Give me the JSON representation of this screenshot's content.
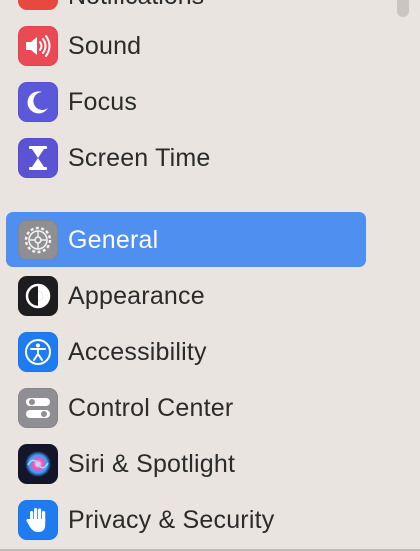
{
  "sidebar": {
    "partial_top_item": {
      "label": "Notifications",
      "icon": "bell-icon"
    },
    "items": [
      {
        "label": "Sound",
        "icon": "speaker-icon",
        "color": "#e8484f"
      },
      {
        "label": "Focus",
        "icon": "moon-icon",
        "color": "#5b58d9"
      },
      {
        "label": "Screen Time",
        "icon": "hourglass-icon",
        "color": "#5b52d4"
      },
      {
        "label": "General",
        "icon": "gear-icon",
        "color": "#8e8e93",
        "selected": true
      },
      {
        "label": "Appearance",
        "icon": "appearance-icon",
        "color": "#1d1d1f"
      },
      {
        "label": "Accessibility",
        "icon": "accessibility-icon",
        "color": "#1f7cf0"
      },
      {
        "label": "Control Center",
        "icon": "toggles-icon",
        "color": "#8e8e93"
      },
      {
        "label": "Siri & Spotlight",
        "icon": "siri-icon",
        "color": "#1a1a2e"
      },
      {
        "label": "Privacy & Security",
        "icon": "hand-icon",
        "color": "#1f7cf0"
      }
    ]
  },
  "colors": {
    "background": "#e9e4df",
    "selection": "#4e8ff0"
  }
}
